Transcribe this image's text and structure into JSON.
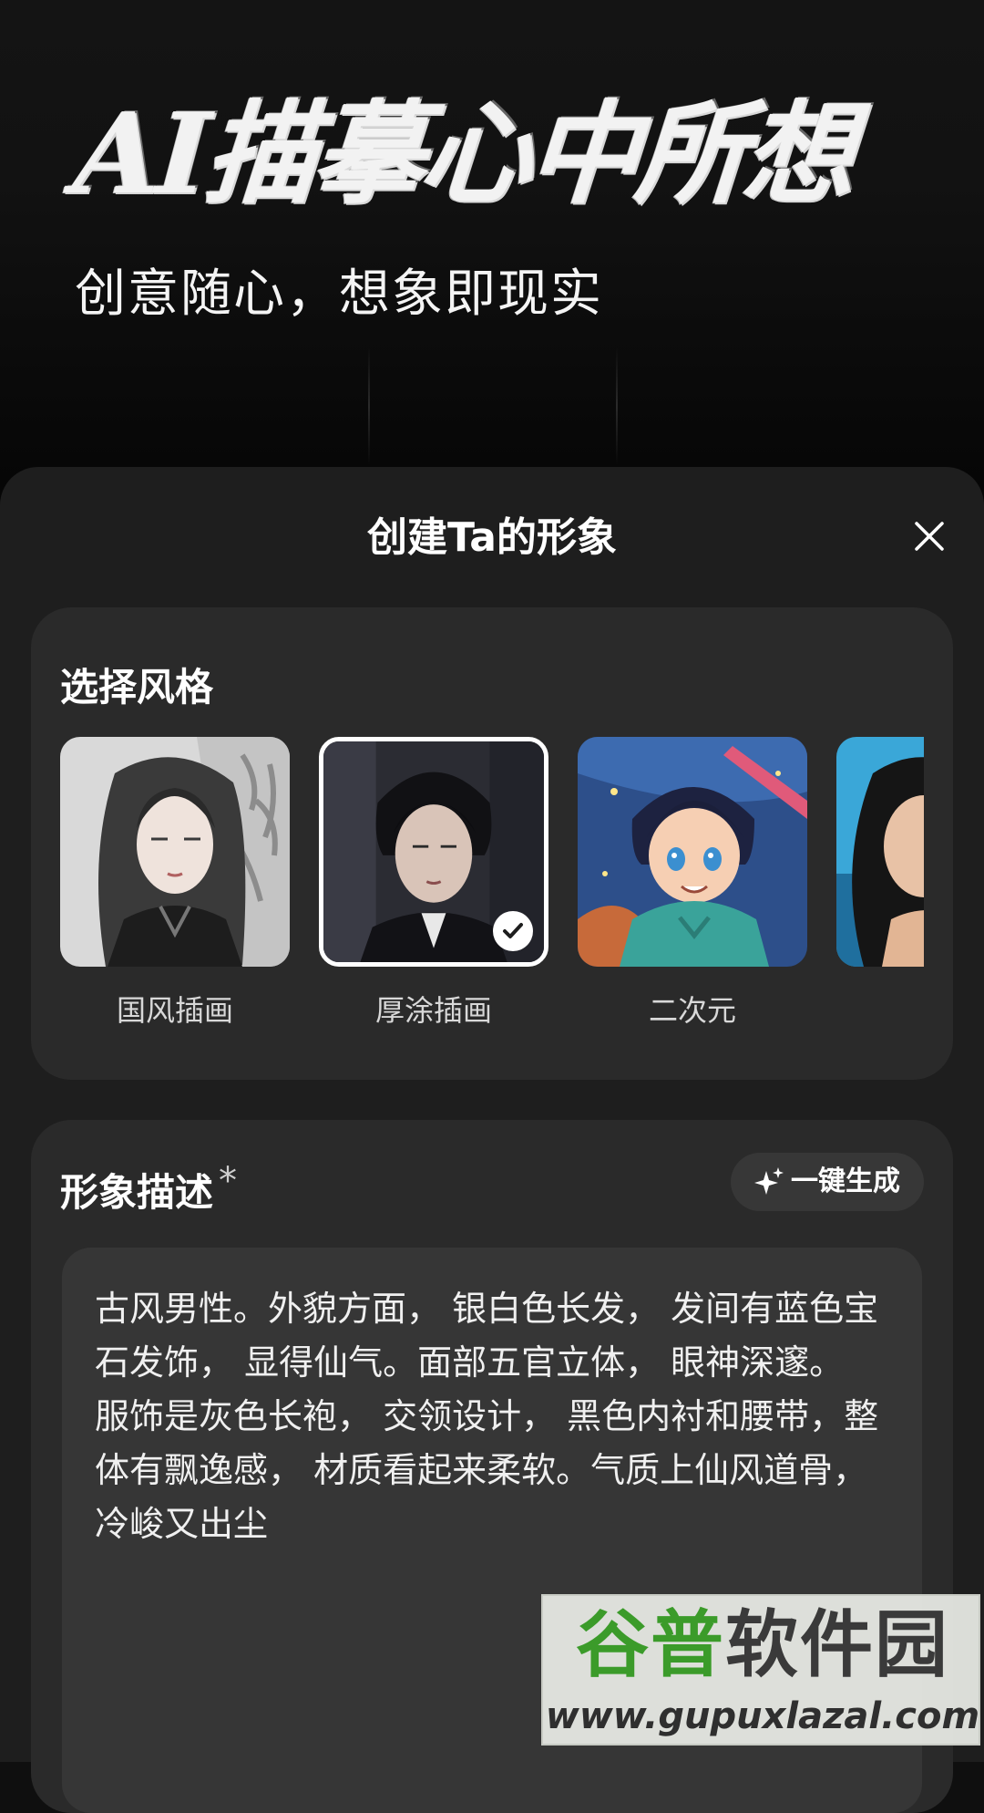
{
  "hero": {
    "title": "AI描摹心中所想",
    "subtitle": "创意随心，想象即现实"
  },
  "sheet": {
    "title": "创建Ta的形象",
    "close_icon": "close-icon"
  },
  "style_section": {
    "heading": "选择风格",
    "items": [
      {
        "label": "国风插画",
        "selected": false,
        "icon": "guofeng-portrait-thumbnail"
      },
      {
        "label": "厚涂插画",
        "selected": true,
        "icon": "thick-paint-portrait-thumbnail"
      },
      {
        "label": "二次元",
        "selected": false,
        "icon": "anime-boy-thumbnail"
      },
      {
        "label": "",
        "selected": false,
        "icon": "realistic-woman-thumbnail"
      }
    ],
    "selected_badge_icon": "checkmark-icon"
  },
  "description_section": {
    "heading": "形象描述",
    "required_mark": "*",
    "generate_button_label": "一键生成",
    "generate_icon": "sparkle-icon",
    "text": "古风男性。外貌方面， 银白色长发， 发间有蓝色宝石发饰， 显得仙气。面部五官立体， 眼神深邃。 服饰是灰色长袍， 交领设计， 黑色内衬和腰带，整体有飘逸感， 材质看起来柔软。气质上仙风道骨， 冷峻又出尘"
  },
  "watermark": {
    "text_green": "谷普",
    "text_dark": "软件园",
    "url": "www.gupuxlazal.com"
  },
  "colors": {
    "background": "#0f0f0f",
    "sheet": "#1e1e1e",
    "card": "#2a2a2a",
    "input": "#363636",
    "text_primary": "#ffffff",
    "watermark_green": "#3b9b2a"
  }
}
